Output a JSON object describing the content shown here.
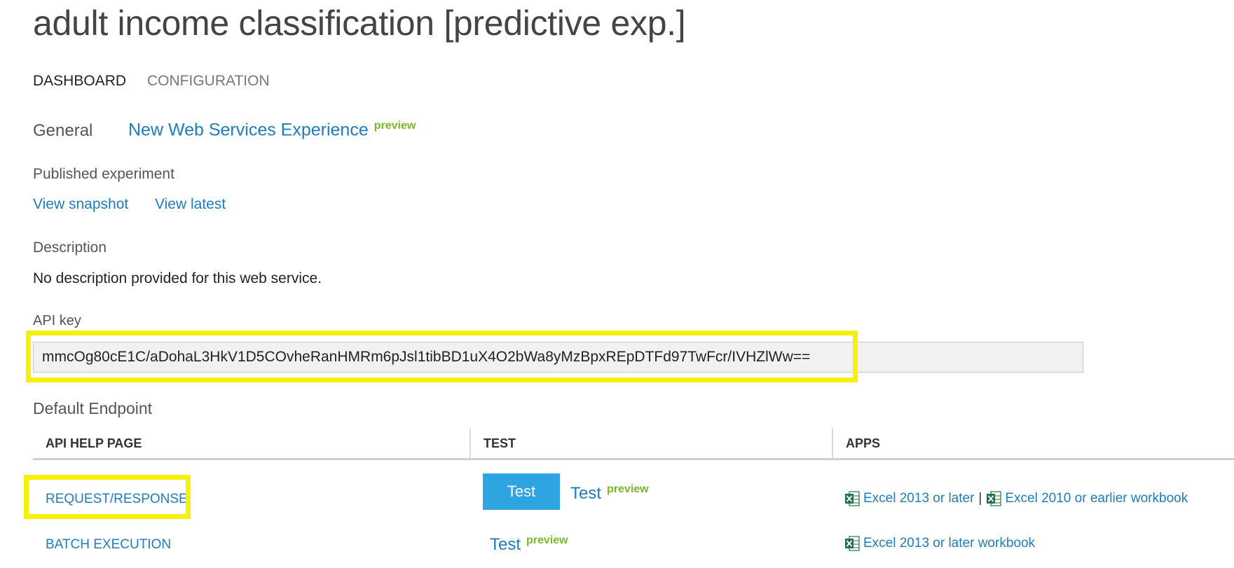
{
  "page": {
    "title": "adult income classification [predictive exp.]"
  },
  "tabs": [
    {
      "label": "DASHBOARD"
    },
    {
      "label": "CONFIGURATION"
    }
  ],
  "general": {
    "label": "General",
    "new_ws_link": "New Web Services Experience",
    "preview_badge": "preview"
  },
  "published": {
    "label": "Published experiment",
    "view_snapshot": "View snapshot",
    "view_latest": "View latest"
  },
  "description": {
    "label": "Description",
    "text": "No description provided for this web service."
  },
  "api_key": {
    "label": "API key",
    "value": "mmcOg80cE1C/aDohaL3HkV1D5COvheRanHMRm6pJsl1tibBD1uX4O2bWa8yMzBpxREpDTFd97TwFcr/IVHZlWw=="
  },
  "endpoint": {
    "title": "Default Endpoint",
    "columns": [
      "API HELP PAGE",
      "TEST",
      "APPS"
    ],
    "rows": [
      {
        "api_help": "REQUEST/RESPONSE",
        "test_button": "Test",
        "test_link": "Test",
        "test_preview": "preview",
        "apps": [
          "Excel 2013 or later",
          "Excel 2010 or earlier workbook"
        ],
        "apps_separator": "|"
      },
      {
        "api_help": "BATCH EXECUTION",
        "test_link": "Test",
        "test_preview": "preview",
        "apps": [
          "Excel 2013 or later workbook"
        ]
      }
    ]
  },
  "colors": {
    "link": "#1e7cc0",
    "preview": "#7ab829",
    "test_button": "#2ea5e0",
    "highlight": "#f7f00a",
    "excel_icon": "#217346"
  },
  "icons": {
    "excel": "excel-icon"
  }
}
